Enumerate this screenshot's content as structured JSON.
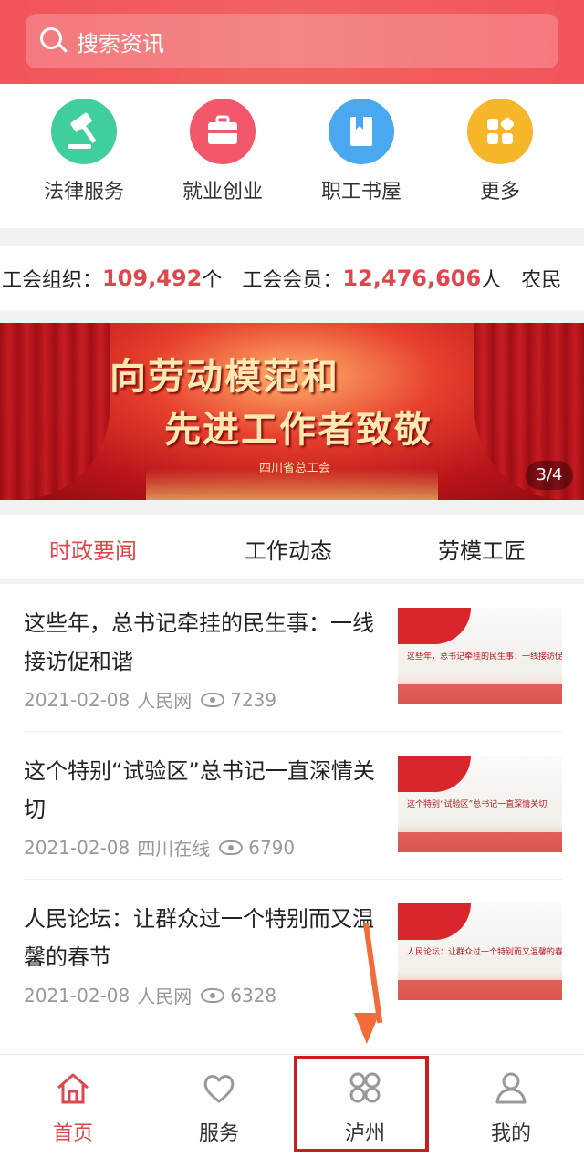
{
  "search": {
    "placeholder": "搜索资讯"
  },
  "quick_services": [
    {
      "label": "法律服务",
      "icon": "gavel-icon",
      "color": "#3fcf9b"
    },
    {
      "label": "就业创业",
      "icon": "briefcase-icon",
      "color": "#f3576a"
    },
    {
      "label": "职工书屋",
      "icon": "book-icon",
      "color": "#4aa8f0"
    },
    {
      "label": "更多",
      "icon": "grid-icon",
      "color": "#f5b629"
    }
  ],
  "stats": {
    "org_label": "工会组织：",
    "org_value": "109,492",
    "org_unit": "个",
    "member_label": "工会会员：",
    "member_value": "12,476,606",
    "member_unit": "人",
    "next_label": "农民"
  },
  "banner": {
    "line1": "向劳动模范和",
    "line2": "先进工作者致敬",
    "org": "四川省总工会",
    "pager": "3/4"
  },
  "tabs": [
    {
      "label": "时政要闻",
      "active": true
    },
    {
      "label": "工作动态",
      "active": false
    },
    {
      "label": "劳模工匠",
      "active": false
    }
  ],
  "news": [
    {
      "title": "这些年，总书记牵挂的民生事：一线接访促和谐",
      "date": "2021-02-08",
      "source": "人民网",
      "views": "7239",
      "thumb_caption": "这些年，总书记牵挂的民生事：一线接访促和谐"
    },
    {
      "title": "这个特别“试验区”总书记一直深情关切",
      "date": "2021-02-08",
      "source": "四川在线",
      "views": "6790",
      "thumb_caption": "这个特别“试验区”总书记一直深情关切"
    },
    {
      "title": "人民论坛：让群众过一个特别而又温馨的春节",
      "date": "2021-02-08",
      "source": "人民网",
      "views": "6328",
      "thumb_caption": "人民论坛：让群众过一个特别而又温馨的春节"
    }
  ],
  "bottom_nav": [
    {
      "label": "首页",
      "icon": "home-icon",
      "active": true
    },
    {
      "label": "服务",
      "icon": "heart-icon",
      "active": false
    },
    {
      "label": "泸州",
      "icon": "apps-icon",
      "active": false
    },
    {
      "label": "我的",
      "icon": "user-icon",
      "active": false
    }
  ],
  "colors": {
    "brand": "#f1545a",
    "accent": "#e0464d",
    "annotation": "#c81e1e"
  }
}
